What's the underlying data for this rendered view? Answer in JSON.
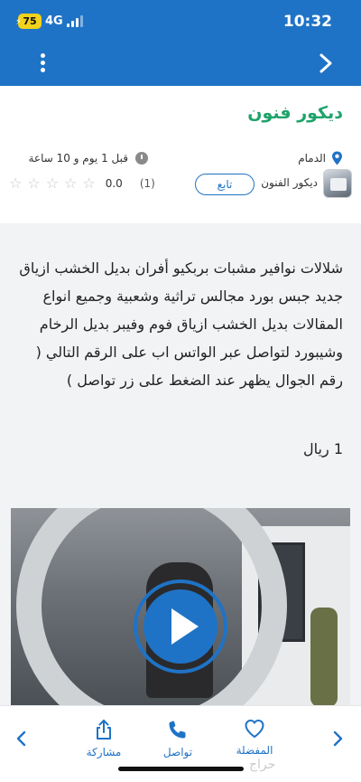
{
  "status_bar": {
    "battery": "75",
    "network": "4G",
    "time": "10:32"
  },
  "header": {
    "title": "ديكور فنون",
    "location": "الدمام",
    "posted_time": "قبل 1 يوم و 10 ساعة",
    "username": "ديكور الفنون",
    "follow_label": "تابع",
    "rating_value": "0.0",
    "rating_count": "(1)",
    "rating_stars": 0
  },
  "body": {
    "description": "شلالات نوافير مشبات بربكيو أفران بديل الخشب ازياق جديد جبس بورد مجالس تراثية وشعبية وجميع انواع المقالات بديل الخشب ازياق فوم وفيبر بديل الرخام وشيبورد لتواصل عبر الواتس اب على الرقم التالي ( رقم الجوال يظهر عند الضغط على زر تواصل )",
    "price": "1 ريال"
  },
  "bottom_bar": {
    "share_label": "مشاركة",
    "contact_label": "تواصل",
    "favorite_label": "المفضلة"
  },
  "watermark": "حراج",
  "colors": {
    "brand_blue": "#1f73c6",
    "title_green": "#1ea36a"
  }
}
